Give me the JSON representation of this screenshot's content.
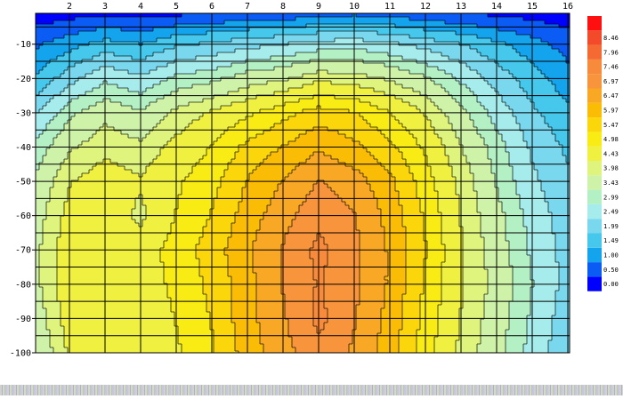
{
  "chart_data": {
    "type": "heatmap",
    "subtype": "filled-contour",
    "x_ticks": [
      2,
      3,
      4,
      5,
      6,
      7,
      8,
      9,
      10,
      11,
      12,
      13,
      14,
      15,
      16
    ],
    "x_range": [
      1.05,
      16.05
    ],
    "y_ticks": [
      -10,
      -20,
      -30,
      -40,
      -50,
      -60,
      -70,
      -80,
      -90,
      -100
    ],
    "y_tick_labels": [
      "-10",
      "-20",
      "-30",
      "-40",
      "-50",
      "-60",
      "-70",
      "-80",
      "-90",
      "-100"
    ],
    "y_range": [
      -100,
      -1
    ],
    "grid": true,
    "legend_position": "right",
    "color_levels": [
      {
        "label": "0.00",
        "color": "#0000ff"
      },
      {
        "label": "0.50",
        "color": "#0a5cf5"
      },
      {
        "label": "1.00",
        "color": "#14a4ee"
      },
      {
        "label": "1.49",
        "color": "#45c8ec"
      },
      {
        "label": "1.99",
        "color": "#7ad8ee"
      },
      {
        "label": "2.49",
        "color": "#a6ecec"
      },
      {
        "label": "2.99",
        "color": "#b3f0c4"
      },
      {
        "label": "3.43",
        "color": "#cdf2a8"
      },
      {
        "label": "3.98",
        "color": "#def47c"
      },
      {
        "label": "4.43",
        "color": "#f0f040"
      },
      {
        "label": "4.98",
        "color": "#f8ec14"
      },
      {
        "label": "5.47",
        "color": "#fad60a"
      },
      {
        "label": "5.97",
        "color": "#fbbc05"
      },
      {
        "label": "6.47",
        "color": "#f9a826"
      },
      {
        "label": "6.97",
        "color": "#f7943c"
      },
      {
        "label": "7.46",
        "color": "#f88a3c"
      },
      {
        "label": "7.96",
        "color": "#f46a32"
      },
      {
        "label": "8.46",
        "color": "#f24a2a"
      },
      {
        "label": "",
        "color": "#ff1010"
      }
    ],
    "z_grid_x": [
      1,
      2,
      3,
      4,
      5,
      6,
      7,
      8,
      9,
      10,
      11,
      12,
      13,
      14,
      15,
      16
    ],
    "z_grid_y": [
      -1,
      -10,
      -20,
      -30,
      -40,
      -50,
      -60,
      -70,
      -80,
      -90,
      -100
    ],
    "z_values": [
      [
        0.2,
        0.3,
        0.4,
        0.3,
        0.4,
        0.5,
        0.6,
        0.6,
        0.8,
        0.9,
        0.8,
        0.6,
        0.5,
        0.4,
        0.3,
        0.2
      ],
      [
        0.9,
        1.3,
        1.7,
        1.5,
        1.9,
        2.1,
        2.3,
        2.5,
        2.7,
        2.8,
        2.6,
        2.3,
        2.0,
        1.6,
        1.2,
        0.8
      ],
      [
        1.5,
        2.3,
        2.9,
        2.6,
        3.1,
        3.3,
        3.7,
        3.9,
        4.3,
        4.2,
        3.9,
        3.5,
        2.9,
        2.3,
        1.7,
        1.2
      ],
      [
        2.4,
        3.3,
        3.8,
        3.5,
        4.1,
        4.5,
        4.9,
        5.3,
        5.7,
        5.5,
        5.0,
        4.4,
        3.6,
        2.8,
        2.1,
        1.6
      ],
      [
        3.1,
        3.9,
        4.3,
        4.1,
        4.6,
        5.0,
        5.6,
        6.0,
        6.4,
        6.1,
        5.6,
        4.9,
        4.0,
        3.2,
        2.4,
        1.9
      ],
      [
        3.5,
        4.4,
        4.7,
        4.5,
        4.9,
        5.3,
        6.0,
        6.5,
        7.0,
        6.7,
        6.1,
        5.2,
        4.3,
        3.4,
        2.6,
        2.1
      ],
      [
        3.7,
        4.6,
        4.8,
        4.3,
        5.0,
        5.5,
        6.2,
        6.8,
        7.3,
        7.0,
        6.3,
        5.4,
        4.4,
        3.6,
        2.8,
        2.2
      ],
      [
        3.8,
        4.8,
        4.9,
        4.7,
        5.2,
        5.7,
        6.4,
        7.0,
        7.6,
        7.1,
        6.4,
        5.5,
        4.5,
        3.7,
        2.9,
        2.3
      ],
      [
        3.8,
        4.8,
        4.9,
        4.7,
        5.1,
        5.6,
        6.3,
        7.0,
        7.5,
        7.1,
        6.4,
        5.4,
        4.5,
        3.8,
        3.0,
        2.3
      ],
      [
        3.6,
        4.7,
        4.8,
        4.6,
        5.0,
        5.5,
        6.3,
        6.9,
        7.6,
        7.0,
        6.3,
        5.3,
        4.4,
        3.7,
        2.9,
        2.2
      ],
      [
        3.4,
        4.5,
        4.7,
        4.6,
        4.9,
        5.4,
        6.2,
        6.8,
        7.3,
        6.9,
        6.2,
        5.2,
        4.3,
        3.6,
        2.8,
        2.1
      ]
    ]
  }
}
